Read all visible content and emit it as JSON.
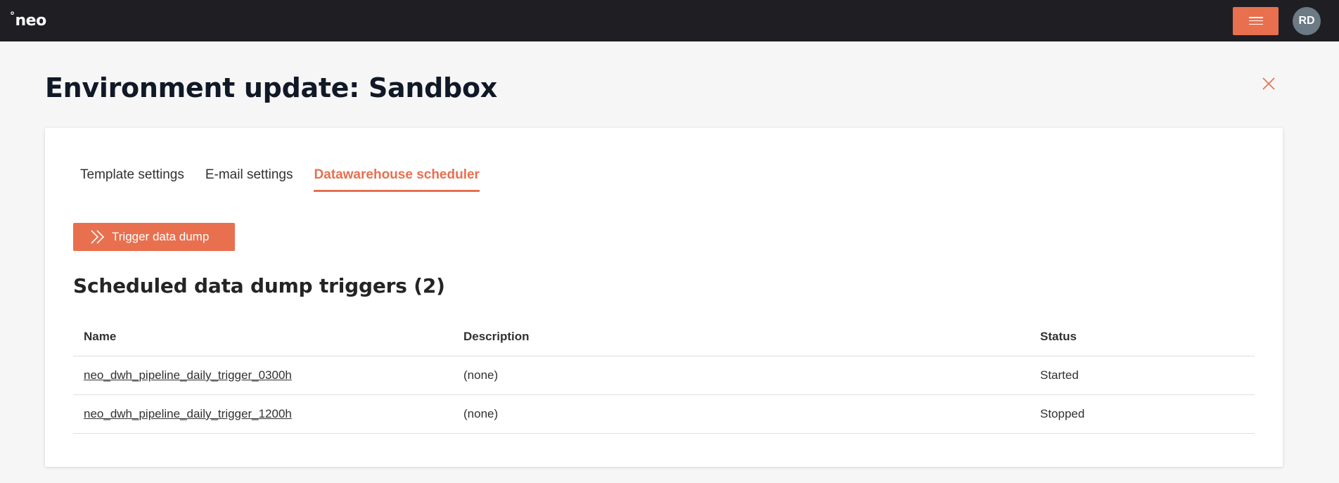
{
  "app": {
    "logo_degree": "°",
    "logo_text": "neo"
  },
  "header": {
    "avatar_initials": "RD"
  },
  "page": {
    "title": "Environment update: Sandbox"
  },
  "tabs": [
    {
      "label": "Template settings",
      "active": false
    },
    {
      "label": "E-mail settings",
      "active": false
    },
    {
      "label": "Datawarehouse scheduler",
      "active": true
    }
  ],
  "actions": {
    "trigger_label": "Trigger data dump"
  },
  "section": {
    "title": "Scheduled data dump triggers (2)"
  },
  "table": {
    "columns": [
      "Name",
      "Description",
      "Status"
    ],
    "rows": [
      {
        "name": "neo_dwh_pipeline_daily_trigger_0300h",
        "description": "(none)",
        "status": "Started"
      },
      {
        "name": "neo_dwh_pipeline_daily_trigger_1200h",
        "description": "(none)",
        "status": "Stopped"
      }
    ]
  },
  "icons": {
    "menu": "hamburger-icon",
    "close": "close-icon",
    "trigger": "double-chevron-right-icon"
  },
  "colors": {
    "topbar": "#1f1f23",
    "accent": "#e8704f",
    "avatar": "#6b7a85",
    "background": "#f6f6f6"
  }
}
